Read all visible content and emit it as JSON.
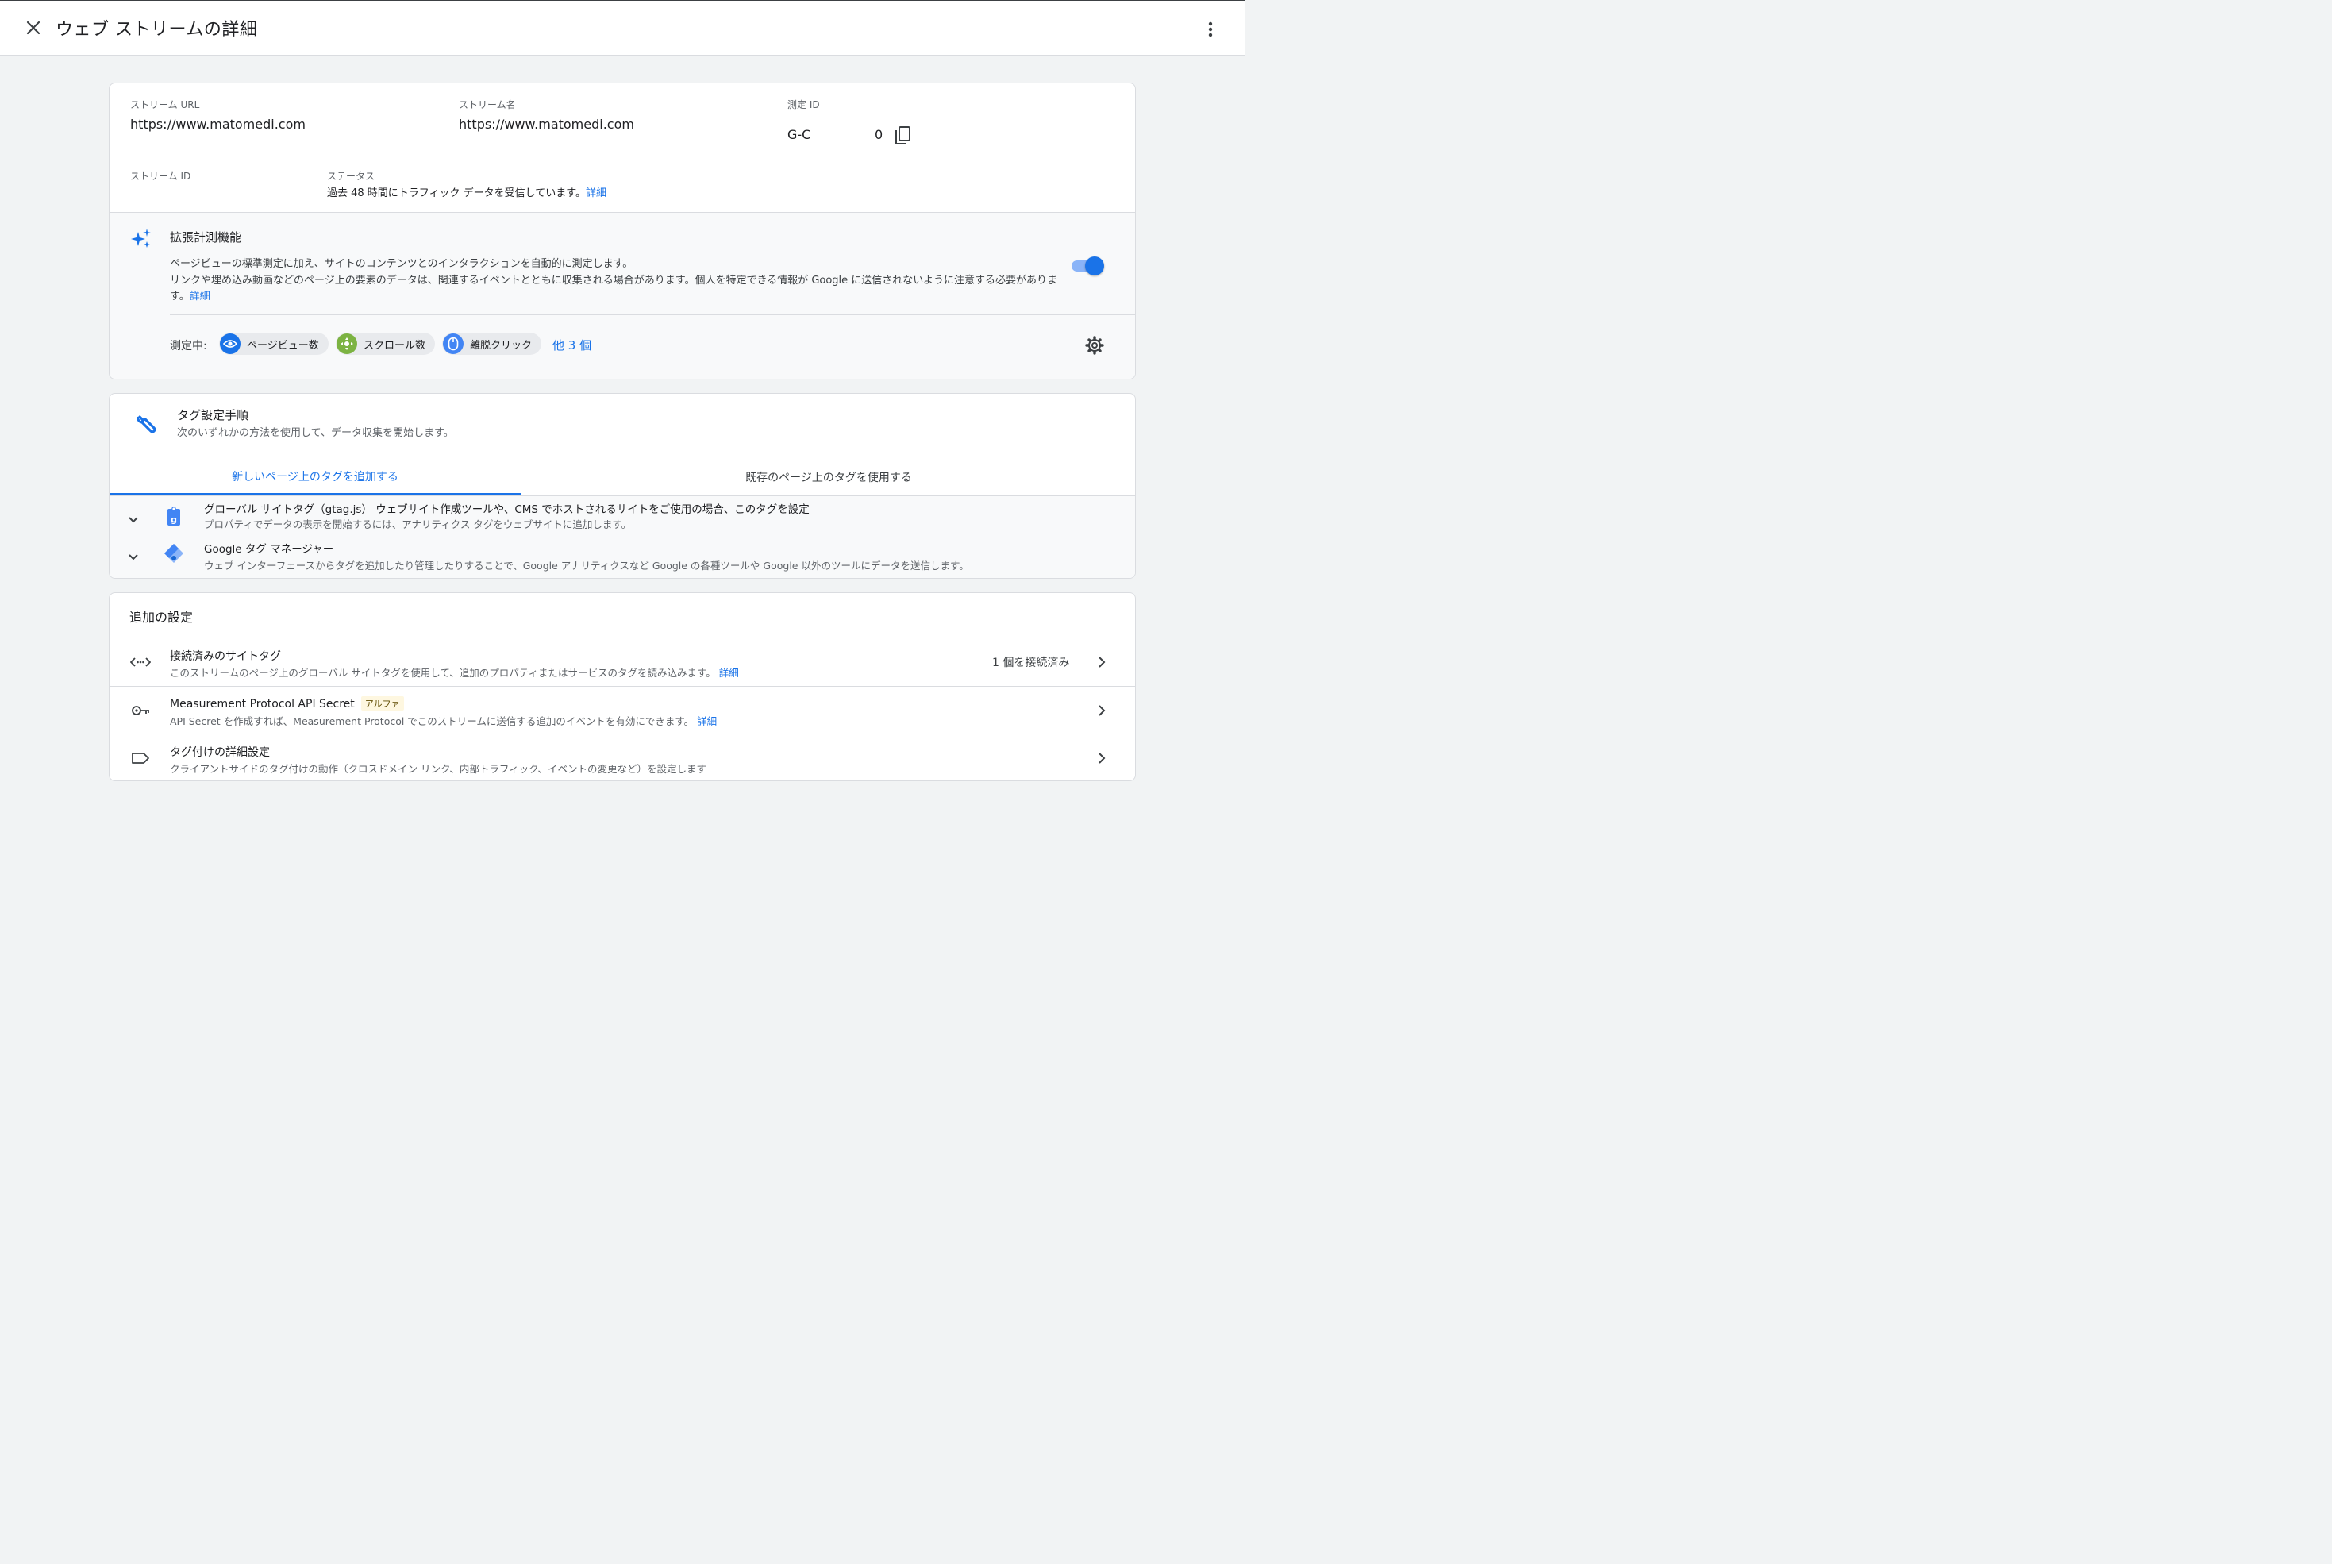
{
  "header": {
    "title": "ウェブ ストリームの詳細"
  },
  "stream": {
    "url_label": "ストリーム URL",
    "url_value": "https://www.matomedi.com",
    "name_label": "ストリーム名",
    "name_value": "https://www.matomedi.com",
    "measurement_id_label": "測定 ID",
    "measurement_id_prefix": "G-C",
    "measurement_id_suffix": "0",
    "stream_id_label": "ストリーム ID",
    "status_label": "ステータス",
    "status_text": "過去 48 時間にトラフィック データを受信しています。",
    "status_link": "詳細"
  },
  "enhanced": {
    "title": "拡張計測機能",
    "desc_line1": "ページビューの標準測定に加え、サイトのコンテンツとのインタラクションを自動的に測定します。",
    "desc_line2": "リンクや埋め込み動画などのページ上の要素のデータは、関連するイベントとともに収集される場合があります。個人を特定できる情報が Google に送信されないように注意する必要がありま",
    "desc_line3": "す。",
    "desc_link": "詳細",
    "enabled": true,
    "measuring_label": "測定中:",
    "chips": [
      {
        "label": "ページビュー数",
        "icon": "eye-icon",
        "color": "#1a73e8"
      },
      {
        "label": "スクロール数",
        "icon": "scroll-icon",
        "color": "#7cb342"
      },
      {
        "label": "離脱クリック",
        "icon": "mouse-icon",
        "color": "#4285f4"
      }
    ],
    "more_link": "他 3 個"
  },
  "tagging": {
    "title": "タグ設定手順",
    "subtitle": "次のいずれかの方法を使用して、データ収集を開始します。",
    "tabs": [
      {
        "label": "新しいページ上のタグを追加する",
        "active": true
      },
      {
        "label": "既存のページ上のタグを使用する",
        "active": false
      }
    ],
    "methods": [
      {
        "title": "グローバル サイトタグ（gtag.js） ウェブサイト作成ツールや、CMS でホストされるサイトをご使用の場合、このタグを設定",
        "subtitle": "プロパティでデータの表示を開始するには、アナリティクス タグをウェブサイトに追加します。",
        "icon": "gtag-icon"
      },
      {
        "title": "Google タグ マネージャー",
        "subtitle": "ウェブ インターフェースからタグを追加したり管理したりすることで、Google アナリティクスなど Google の各種ツールや Google 以外のツールにデータを送信します。",
        "icon": "tag-manager-icon"
      }
    ]
  },
  "additional": {
    "title": "追加の設定",
    "rows": [
      {
        "title": "接続済みのサイトタグ",
        "subtitle": "このストリームのページ上のグローバル サイトタグを使用して、追加のプロパティまたはサービスのタグを読み込みます。",
        "link": "詳細",
        "status": "1 個を接続済み",
        "icon": "code-icon"
      },
      {
        "title": "Measurement Protocol API Secret",
        "badge": "アルファ",
        "subtitle": "API Secret を作成すれば、Measurement Protocol でこのストリームに送信する追加のイベントを有効にできます。",
        "link": "詳細",
        "icon": "key-icon"
      },
      {
        "title": "タグ付けの詳細設定",
        "subtitle": "クライアントサイドのタグ付けの動作（クロスドメイン リンク、内部トラフィック、イベントの変更など）を設定します",
        "icon": "label-icon"
      }
    ]
  }
}
